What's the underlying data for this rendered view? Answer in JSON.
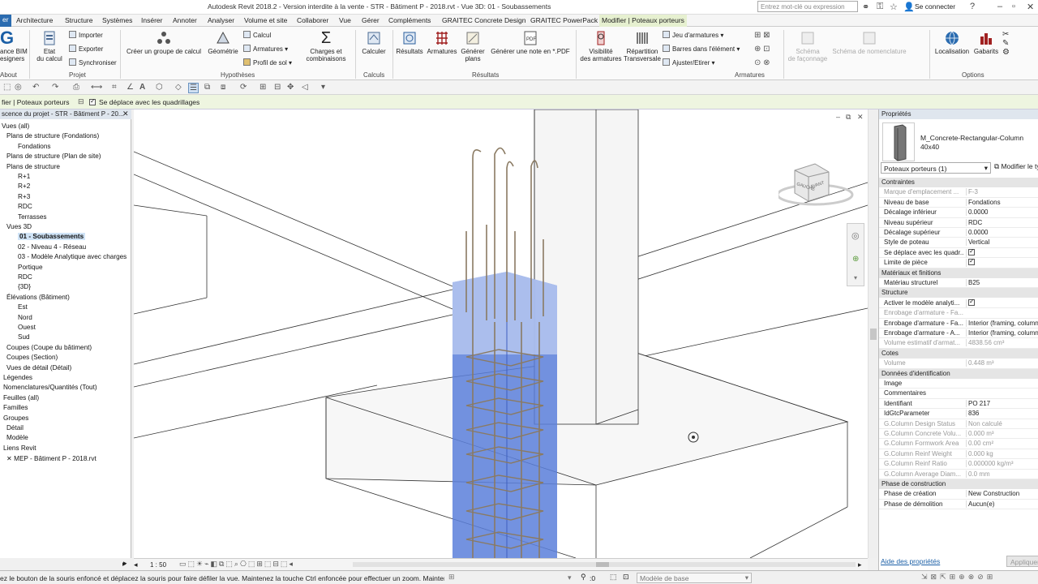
{
  "window": {
    "title": "Autodesk Revit 2018.2 - Version interdite à la vente -    STR - Bâtiment P - 2018.rvt - Vue 3D: 01 - Soubassements"
  },
  "search": {
    "placeholder": "Entrez mot-clé ou expression"
  },
  "signin": "Se connecter",
  "tabs": [
    {
      "label": "er",
      "active": true
    },
    {
      "label": "Architecture"
    },
    {
      "label": "Structure"
    },
    {
      "label": "Systèmes"
    },
    {
      "label": "Insérer"
    },
    {
      "label": "Annoter"
    },
    {
      "label": "Analyser"
    },
    {
      "label": "Volume et site"
    },
    {
      "label": "Collaborer"
    },
    {
      "label": "Vue"
    },
    {
      "label": "Gérer"
    },
    {
      "label": "Compléments"
    },
    {
      "label": "GRAITEC Concrete Design"
    },
    {
      "label": "GRAITEC PowerPack"
    },
    {
      "label": "Modifier | Poteaux porteurs"
    }
  ],
  "ribbon": {
    "about_btn": "ance BIM\nesigners",
    "about_grp": "About",
    "etat": "Etat\ndu calcul",
    "importer": "Importer",
    "exporter": "Exporter",
    "synchroniser": "Synchroniser",
    "projet_grp": "Projet",
    "creer_groupe": "Créer un groupe de calcul",
    "geometrie": "Géométrie",
    "calcul_small": "Calcul",
    "armatures_small": "Armatures",
    "profil_sol": "Profil de sol",
    "charges": "Charges et\ncombinaisons",
    "hypotheses_grp": "Hypothèses",
    "calculer": "Calculer",
    "calculs_grp": "Calculs",
    "resultats": "Résultats",
    "armatures": "Armatures",
    "generer_plans": "Générer\nplans",
    "generer_note": "Générer une note en *.PDF",
    "resultats_grp": "Résultats",
    "visibilite": "Visibilité\ndes armatures",
    "repartition": "Répartition\nTransversale",
    "jeu_armatures": "Jeu d'armatures",
    "barres_element": "Barres dans l'élément",
    "ajuster": "Ajuster/Etirer",
    "armatures_grp": "Armatures",
    "schema_faconnage": "Schéma\nde façonnage",
    "schema_nomenclature": "Schéma de nomenclature",
    "localisation": "Localisation",
    "gabarits": "Gabarits",
    "options_grp": "Options"
  },
  "optbar": {
    "context": "fier | Poteaux porteurs",
    "checkbox_label": "Se déplace avec les quadrillages"
  },
  "browser": {
    "title": "scence du projet - STR - Bâtiment P - 20...",
    "items": [
      "Vues (all)",
      "Plans de structure (Fondations)",
      "Fondations",
      "Plans de structure (Plan de site)",
      "Plans de structure",
      "R+1",
      "R+2",
      "R+3",
      "RDC",
      "Terrasses",
      "Vues 3D",
      "01 - Soubassements",
      "02 - Niveau 4 - Réseau",
      "03 - Modèle Analytique avec charges",
      "Portique",
      "RDC",
      "{3D}",
      "Élévations (Bâtiment)",
      "Est",
      "Nord",
      "Ouest",
      "Sud",
      "Coupes (Coupe du bâtiment)",
      "Coupes (Section)",
      "Vues de détail (Détail)",
      "Légendes",
      "Nomenclatures/Quantités (Tout)",
      "Feuilles (all)",
      "Familles",
      "Groupes",
      "Détail",
      "Modèle",
      "Liens Revit",
      "MEP - Bâtiment P - 2018.rvt"
    ]
  },
  "viewcube": {
    "left": "GAUCHE",
    "front": "AVANT"
  },
  "view_scale": "1 : 50",
  "properties": {
    "title": "Propriétés",
    "family": "M_Concrete-Rectangular-Column",
    "type": "40x40",
    "selector": "Poteaux porteurs (1)",
    "edit_type": "Modifier le type",
    "sections": [
      {
        "name": "Contraintes",
        "rows": [
          {
            "k": "Marque d'emplacement ...",
            "v": "F-3",
            "grey": true
          },
          {
            "k": "Niveau de base",
            "v": "Fondations"
          },
          {
            "k": "Décalage inférieur",
            "v": "0.0000"
          },
          {
            "k": "Niveau supérieur",
            "v": "RDC"
          },
          {
            "k": "Décalage supérieur",
            "v": "0.0000"
          },
          {
            "k": "Style de poteau",
            "v": "Vertical"
          },
          {
            "k": "Se déplace avec les quadr...",
            "v": "",
            "check": true
          },
          {
            "k": "Limite de pièce",
            "v": "",
            "check": true
          }
        ]
      },
      {
        "name": "Matériaux et finitions",
        "rows": [
          {
            "k": "Matériau structurel",
            "v": "B25"
          }
        ]
      },
      {
        "name": "Structure",
        "rows": [
          {
            "k": "Activer le modèle analyti...",
            "v": "",
            "check": true
          },
          {
            "k": "Enrobage d'armature - Fa...",
            "v": "",
            "grey": true
          },
          {
            "k": "Enrobage d'armature - Fa...",
            "v": "Interior (framing, column"
          },
          {
            "k": "Enrobage d'armature - A...",
            "v": "Interior (framing, column"
          },
          {
            "k": "Volume estimatif d'armat...",
            "v": "4838.56 cm³",
            "grey": true
          }
        ]
      },
      {
        "name": "Cotes",
        "rows": [
          {
            "k": "Volume",
            "v": "0.448 m³",
            "grey": true
          }
        ]
      },
      {
        "name": "Données d'identification",
        "rows": [
          {
            "k": "Image",
            "v": ""
          },
          {
            "k": "Commentaires",
            "v": ""
          },
          {
            "k": "Identifiant",
            "v": "PO 217"
          },
          {
            "k": "IdGtcParameter",
            "v": "836"
          },
          {
            "k": "G.Column Design Status",
            "v": "Non calculé",
            "grey": true
          },
          {
            "k": "G.Column Concrete Volu...",
            "v": "0.000 m³",
            "grey": true
          },
          {
            "k": "G.Column Formwork Area",
            "v": "0.00 cm²",
            "grey": true
          },
          {
            "k": "G.Column Reinf Weight",
            "v": "0.000 kg",
            "grey": true
          },
          {
            "k": "G.Column Reinf Ratio",
            "v": "0.000000 kg/m³",
            "grey": true
          },
          {
            "k": "G.Column Average Diam...",
            "v": "0.0 mm",
            "grey": true
          }
        ]
      },
      {
        "name": "Phase de construction",
        "rows": [
          {
            "k": "Phase de création",
            "v": "New Construction"
          },
          {
            "k": "Phase de démolition",
            "v": "Aucun(e)"
          }
        ]
      }
    ],
    "help_link": "Aide des propriétés",
    "apply": "Appliquer"
  },
  "status": {
    "message": "ez le bouton de la souris enfoncé et déplacez la souris pour faire défiler la vue. Maintenez la touche Ctrl enfoncée pour effectuer un zoom. Maintenez",
    "count": ":0",
    "model": "Modèle de base"
  }
}
